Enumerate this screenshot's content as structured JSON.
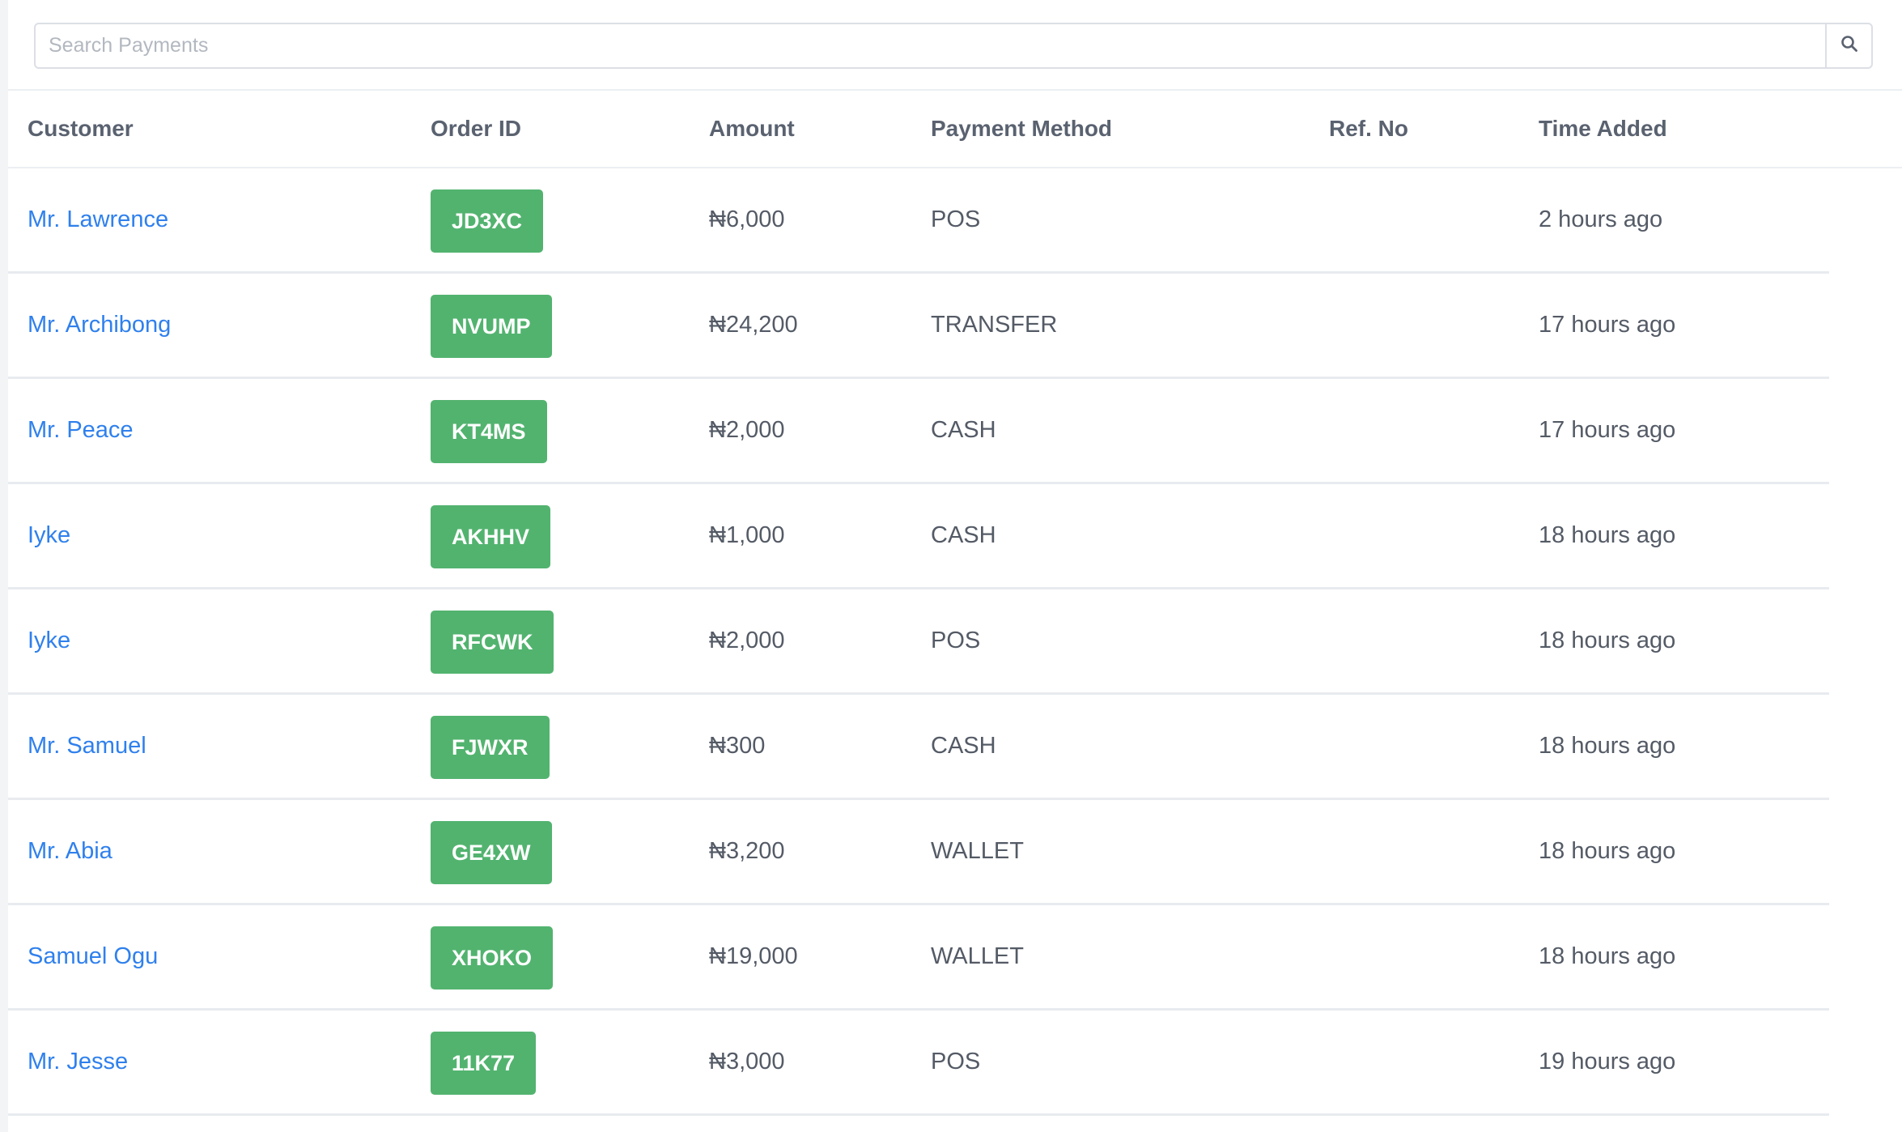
{
  "search": {
    "placeholder": "Search Payments",
    "value": "",
    "button_icon": "search-icon"
  },
  "columns": [
    "Customer",
    "Order ID",
    "Amount",
    "Payment Method",
    "Ref. No",
    "Time Added"
  ],
  "rows": [
    {
      "customer": "Mr. Lawrence",
      "order_id": "JD3XC",
      "amount": "₦6,000",
      "method": "POS",
      "ref_no": "",
      "time": "2 hours ago"
    },
    {
      "customer": "Mr. Archibong",
      "order_id": "NVUMP",
      "amount": "₦24,200",
      "method": "TRANSFER",
      "ref_no": "",
      "time": "17 hours ago"
    },
    {
      "customer": "Mr. Peace",
      "order_id": "KT4MS",
      "amount": "₦2,000",
      "method": "CASH",
      "ref_no": "",
      "time": "17 hours ago"
    },
    {
      "customer": "Iyke",
      "order_id": "AKHHV",
      "amount": "₦1,000",
      "method": "CASH",
      "ref_no": "",
      "time": "18 hours ago"
    },
    {
      "customer": "Iyke",
      "order_id": "RFCWK",
      "amount": "₦2,000",
      "method": "POS",
      "ref_no": "",
      "time": "18 hours ago"
    },
    {
      "customer": "Mr. Samuel",
      "order_id": "FJWXR",
      "amount": "₦300",
      "method": "CASH",
      "ref_no": "",
      "time": "18 hours ago"
    },
    {
      "customer": "Mr. Abia",
      "order_id": "GE4XW",
      "amount": "₦3,200",
      "method": "WALLET",
      "ref_no": "",
      "time": "18 hours ago"
    },
    {
      "customer": "Samuel Ogu",
      "order_id": "XHOKO",
      "amount": "₦19,000",
      "method": "WALLET",
      "ref_no": "",
      "time": "18 hours ago"
    },
    {
      "customer": "Mr. Jesse",
      "order_id": "11K77",
      "amount": "₦3,000",
      "method": "POS",
      "ref_no": "",
      "time": "19 hours ago"
    }
  ],
  "colors": {
    "link": "#2f80ed",
    "badge": "#52b36f",
    "text": "#545b66",
    "header_text": "#5a6270"
  }
}
